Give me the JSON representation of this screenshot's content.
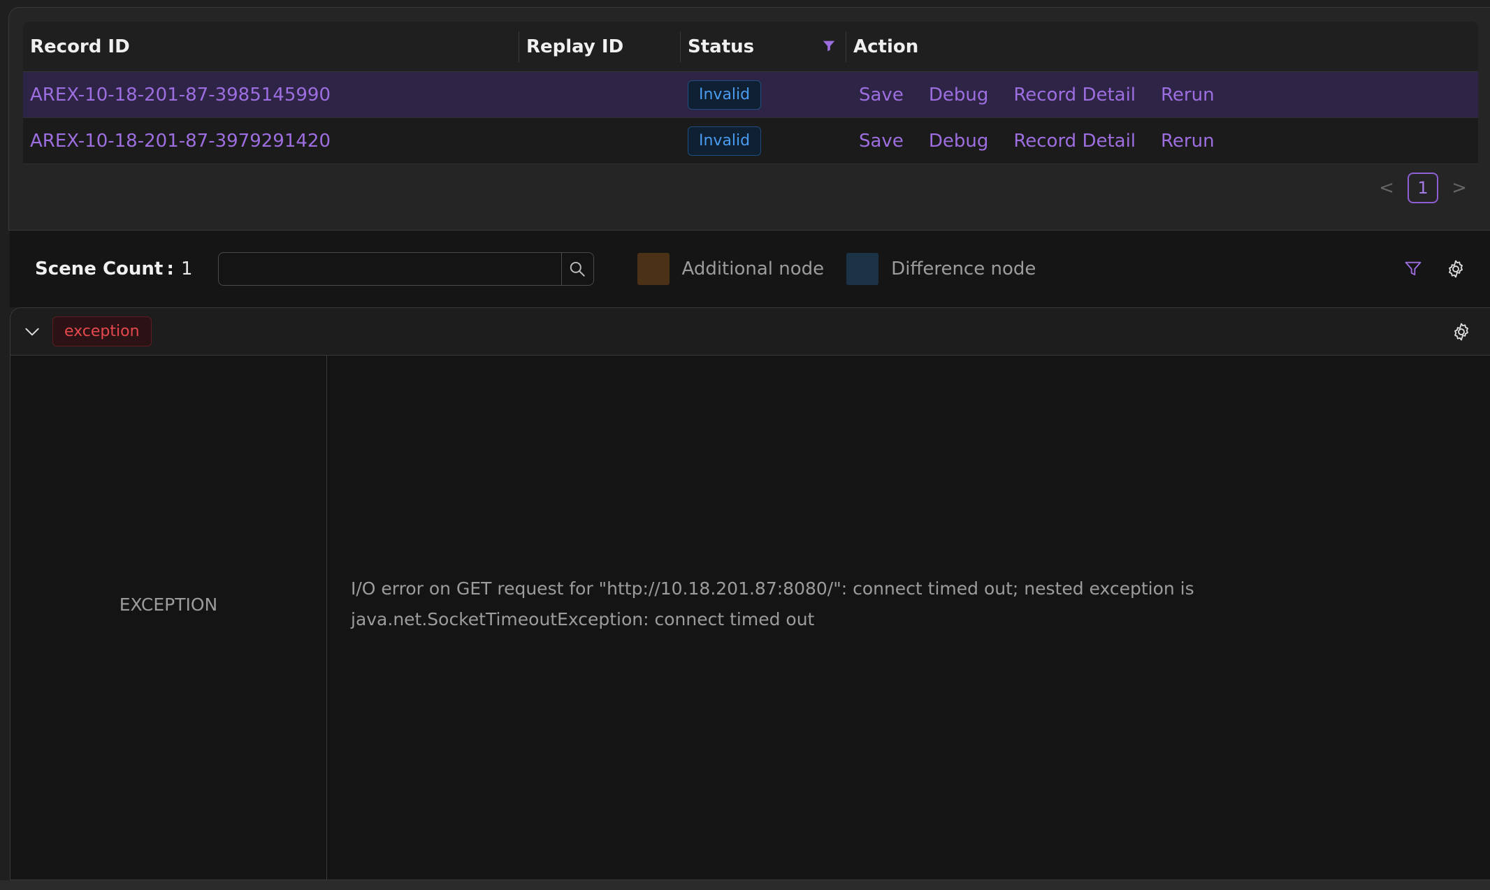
{
  "table": {
    "columns": {
      "record_id": "Record ID",
      "replay_id": "Replay ID",
      "status": "Status",
      "action": "Action"
    },
    "rows": [
      {
        "record_id": "AREX-10-18-201-87-3985145990",
        "replay_id": "",
        "status": "Invalid",
        "actions": [
          "Save",
          "Debug",
          "Record Detail",
          "Rerun"
        ],
        "selected": true
      },
      {
        "record_id": "AREX-10-18-201-87-3979291420",
        "replay_id": "",
        "status": "Invalid",
        "actions": [
          "Save",
          "Debug",
          "Record Detail",
          "Rerun"
        ],
        "selected": false
      }
    ]
  },
  "pagination": {
    "prev": "<",
    "current_page": "1",
    "next": ">"
  },
  "toolbar": {
    "scene_count_label": "Scene Count :",
    "scene_count_value": "1",
    "search_value": "",
    "legend": [
      {
        "label": "Additional node",
        "color": "#4b3217"
      },
      {
        "label": "Difference node",
        "color": "#1c3347"
      }
    ]
  },
  "scene": {
    "tag": "exception",
    "left_label": "EXCEPTION",
    "message": "I/O error on GET request for \"http://10.18.201.87:8080/\": connect timed out; nested exception is java.net.SocketTimeoutException: connect timed out"
  },
  "colors": {
    "accent": "#9d6ee0",
    "invalid_badge": "#4a9cf0",
    "exception_tag": "#e5484d"
  }
}
